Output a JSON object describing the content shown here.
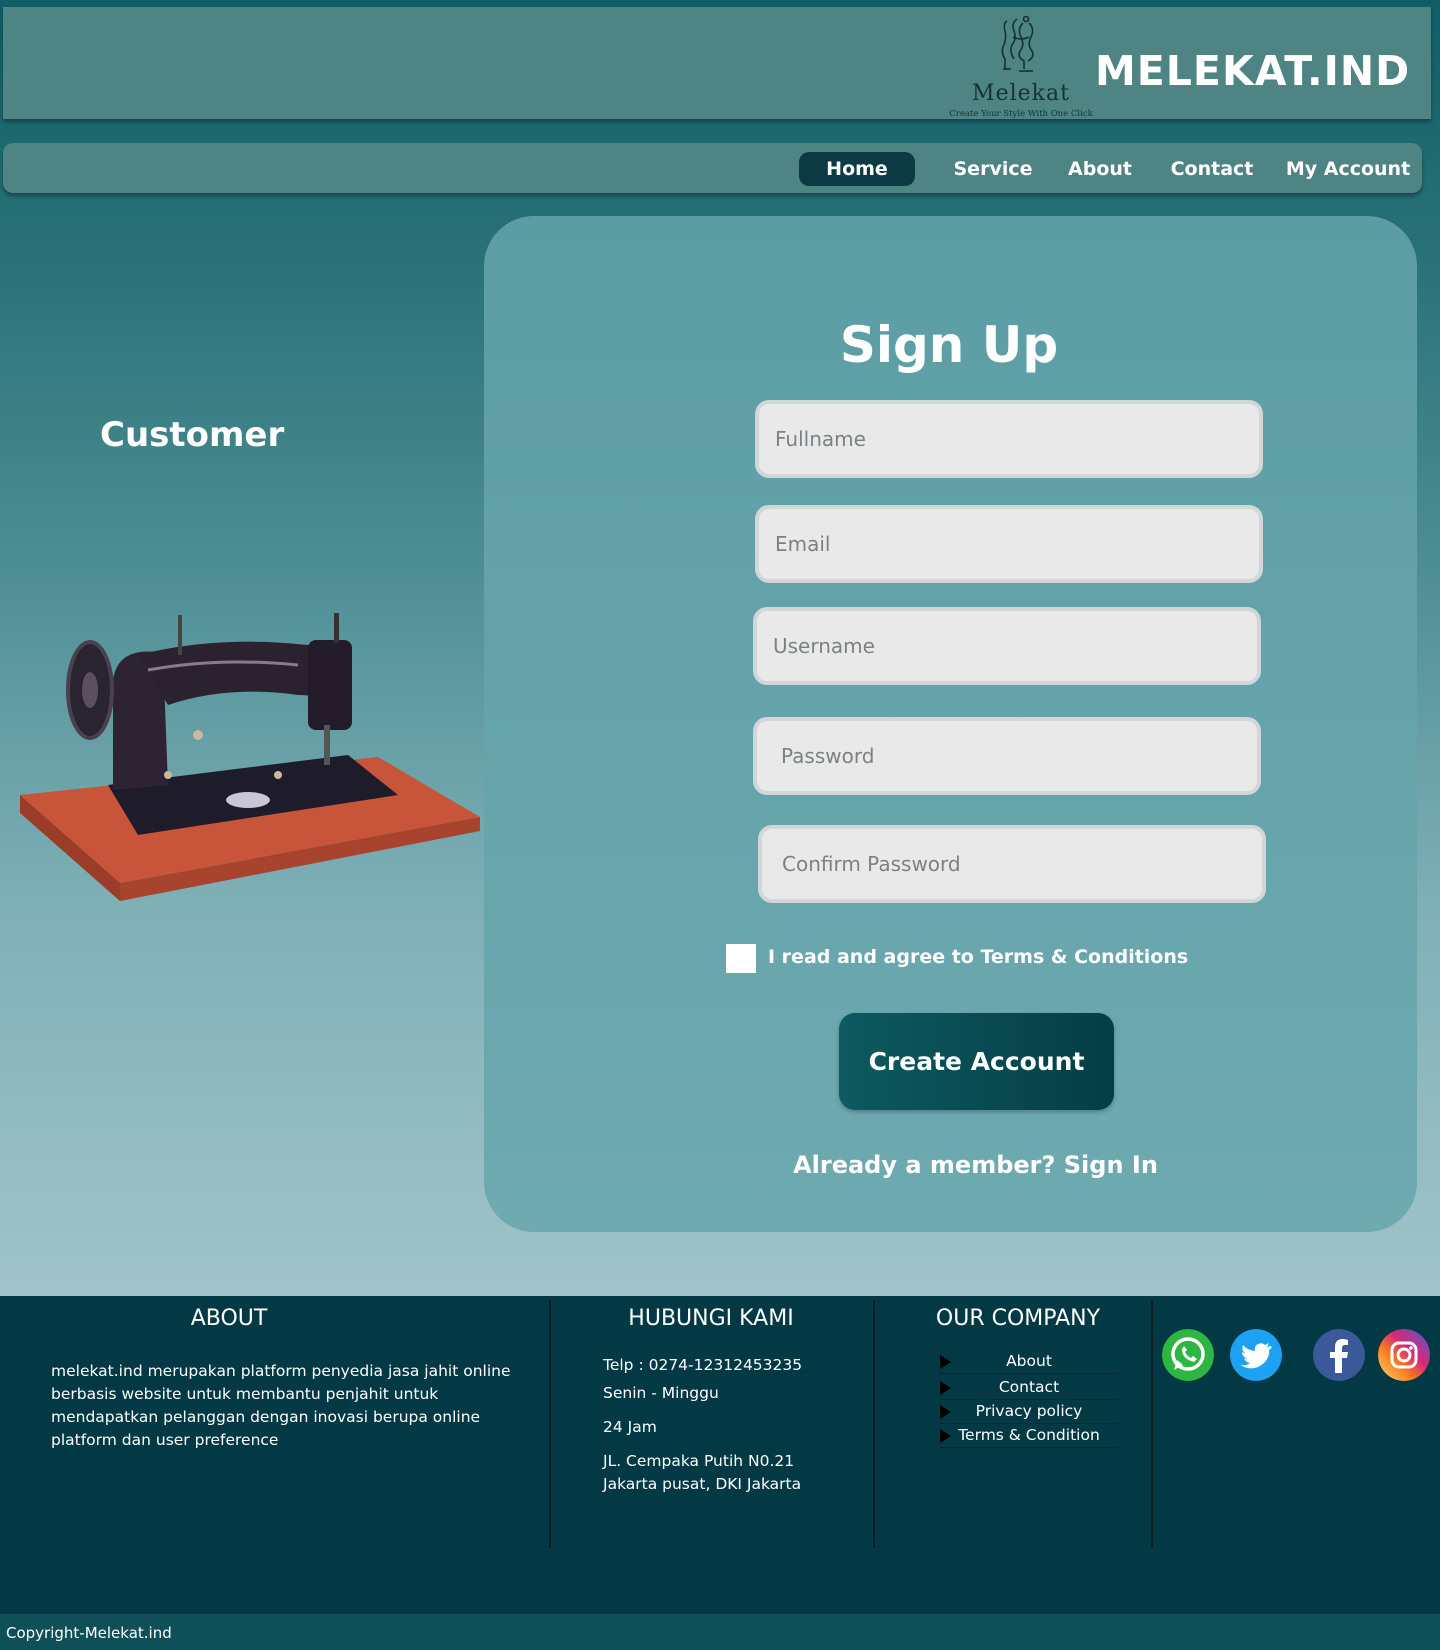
{
  "brand": {
    "logo_name": "Melekat",
    "logo_tagline": "Create Your Style With One Click",
    "title": "MELEKAT.IND"
  },
  "nav": {
    "items": [
      {
        "label": "Home",
        "active": true
      },
      {
        "label": "Service",
        "active": false
      },
      {
        "label": "About",
        "active": false
      },
      {
        "label": "Contact",
        "active": false
      },
      {
        "label": "My Account",
        "active": false
      }
    ]
  },
  "side": {
    "title": "Customer",
    "image_icon": "sewing-machine"
  },
  "signup": {
    "title": "Sign Up",
    "fullname_placeholder": "Fullname",
    "email_placeholder": "Email",
    "username_placeholder": "Username",
    "password_placeholder": "Password",
    "confirm_password_placeholder": "Confirm Password",
    "agree_label": "I  read and agree to Terms & Conditions",
    "agree_checked": false,
    "create_button": "Create Account",
    "signin_link": "Already a member? Sign In"
  },
  "footer": {
    "about": {
      "heading": "ABOUT",
      "text": "melekat.ind merupakan platform penyedia jasa jahit online berbasis website untuk membantu penjahit untuk mendapatkan pelanggan dengan inovasi berupa online platform dan user preference"
    },
    "contact": {
      "heading": "HUBUNGI KAMI",
      "phone": "Telp  :  0274-12312453235",
      "days": "Senin - Minggu",
      "hours": "24 Jam",
      "address_line1": "JL. Cempaka Putih N0.21",
      "address_line2": "Jakarta pusat, DKI Jakarta"
    },
    "company": {
      "heading": "OUR COMPANY",
      "links": [
        "About",
        "Contact",
        "Privacy policy",
        "Terms & Condition"
      ]
    },
    "social": [
      "whatsapp-icon",
      "twitter-icon",
      "facebook-icon",
      "instagram-icon"
    ],
    "copyright": "Copyright-Melekat.ind"
  },
  "colors": {
    "header": "#4e8584",
    "nav_active": "#0c3a42",
    "footer": "#033944",
    "button": "#0d5a60"
  }
}
